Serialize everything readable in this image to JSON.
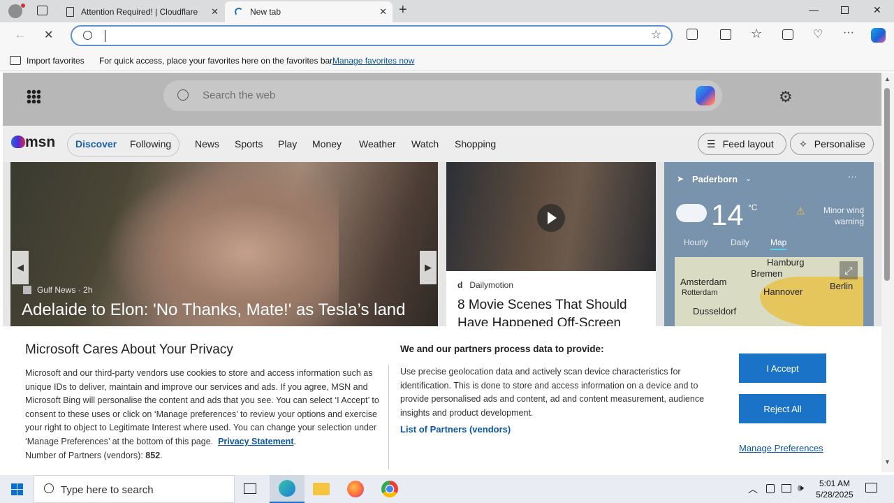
{
  "browser": {
    "tabs": [
      {
        "title": "Attention Required! | Cloudflare"
      },
      {
        "title": "New tab"
      }
    ],
    "favorites_bar": {
      "import_label": "Import favorites",
      "hint": "For quick access, place your favorites here on the favorites bar.",
      "manage_link": "Manage favorites now"
    }
  },
  "msn": {
    "search_placeholder": "Search the web",
    "logo": "msn",
    "pills": [
      "Discover",
      "Following"
    ],
    "nav": [
      "News",
      "Sports",
      "Play",
      "Money",
      "Weather",
      "Watch",
      "Shopping"
    ],
    "feed_layout": "Feed layout",
    "personalise": "Personalise",
    "hero": {
      "source": "Gulf News",
      "age": "2h",
      "title": "Adelaide to Elon: 'No Thanks, Mate!' as Tesla’s land"
    },
    "card2": {
      "source_icon": "d",
      "source": "Dailymotion",
      "title": "8 Movie Scenes That Should Have Happened Off-Screen"
    },
    "weather": {
      "location": "Paderborn",
      "temp": "14",
      "unit": "°C",
      "alert": "Minor wind warning",
      "tabs": [
        "Hourly",
        "Daily",
        "Map"
      ],
      "selected_tab": "Map",
      "map_cities": [
        "Hamburg",
        "Bremen",
        "Amsterdam",
        "Rotterdam",
        "Hannover",
        "Berlin",
        "Dusseldorf"
      ]
    }
  },
  "privacy": {
    "title": "Microsoft Cares About Your Privacy",
    "body": "Microsoft and our third-party vendors use cookies to store and access information such as unique IDs to deliver, maintain and improve our services and ads. If you agree, MSN and Microsoft Bing will personalise the content and ads that you see. You can select ‘I Accept’ to consent to these uses or click on ‘Manage preferences’ to review your options and exercise your right to object to Legitimate Interest where used.  You can change your selection under ‘Manage Preferences’ at the bottom of this page.",
    "privacy_link": "Privacy Statement",
    "partners_count_label": "Number of Partners (vendors):",
    "partners_count": "852",
    "heading2": "We and our partners process data to provide:",
    "body2": "Use precise geolocation data and actively scan device characteristics for identification. This is done to store and access information on a device and to provide personalised ads and content, ad and content measurement, audience insights and product development.",
    "partners_link": "List of Partners (vendors)",
    "accept": "I Accept",
    "reject": "Reject All",
    "manage": "Manage Preferences"
  },
  "taskbar": {
    "search_placeholder": "Type here to search",
    "time": "5:01 AM",
    "date": "5/28/2025"
  },
  "colors": {
    "accent": "#1a73c7",
    "link": "#0b57a4",
    "url_focus": "#5b8fd6"
  }
}
